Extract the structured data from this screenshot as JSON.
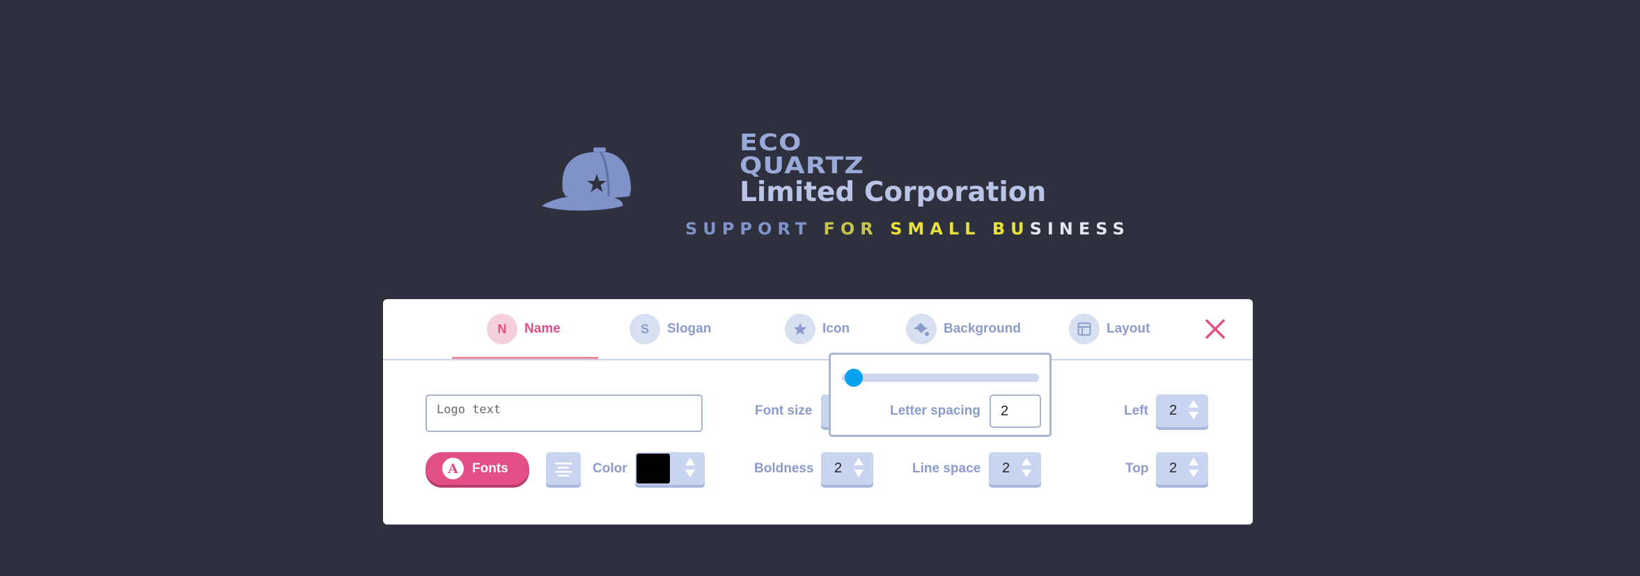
{
  "preview": {
    "cap_icon": "baseball-cap-star-icon",
    "brand_lines": [
      "ECO",
      "QUARTZ"
    ],
    "brand_corp": "Limited Corporation",
    "slogan_parts": [
      {
        "text": "SUPPORT ",
        "color": "#7f93c9"
      },
      {
        "text": "FOR ",
        "color": "#c9c54a"
      },
      {
        "text": "SMALL ",
        "color": "#e8e13a"
      },
      {
        "text": "BU",
        "color": "#e8e13a"
      },
      {
        "text": "SINESS",
        "color": "#e4e7f2"
      }
    ]
  },
  "tabs": [
    {
      "badge": "N",
      "label": "Name",
      "active": true
    },
    {
      "badge": "S",
      "label": "Slogan",
      "active": false
    },
    {
      "badge_icon": "star-icon",
      "label": "Icon",
      "active": false
    },
    {
      "badge_icon": "paint-bucket-icon",
      "label": "Background",
      "active": false
    },
    {
      "badge_icon": "layout-icon",
      "label": "Layout",
      "active": false
    }
  ],
  "close_icon": "close-icon",
  "name_panel": {
    "text_placeholder": "Logo text",
    "fonts_button": {
      "glyph": "A",
      "label": "Fonts"
    },
    "align_icon": "align-center-icon",
    "color_label": "Color",
    "color_value": "#000000",
    "font_size_label": "Font size",
    "boldness_label": "Boldness",
    "boldness_value": "2",
    "line_space_label": "Line space",
    "line_space_value": "2",
    "left_label": "Left",
    "left_value": "2",
    "top_label": "Top",
    "top_value": "2"
  },
  "letter_spacing_popup": {
    "slider_value_fraction": 0.06,
    "label": "Letter spacing",
    "value": "2"
  },
  "colors": {
    "accent": "#e24e86",
    "tab_inactive": "#8a9bcc",
    "slider_knob": "#0aa2f0"
  }
}
